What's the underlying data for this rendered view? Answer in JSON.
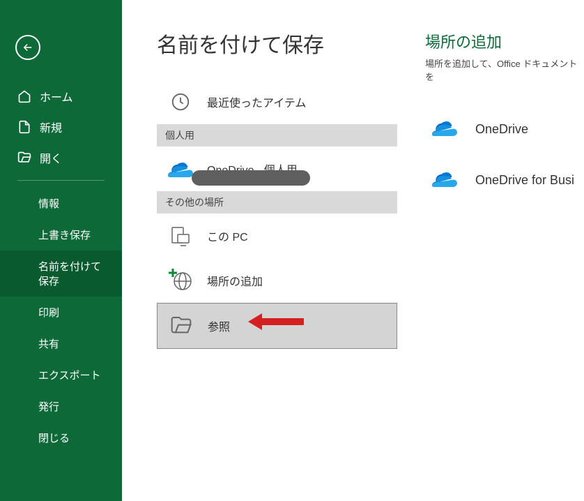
{
  "sidebar": {
    "home": "ホーム",
    "new": "新規",
    "open": "開く",
    "info": "情報",
    "save": "上書き保存",
    "saveas": "名前を付けて保存",
    "print": "印刷",
    "share": "共有",
    "export": "エクスポート",
    "publish": "発行",
    "close": "閉じる"
  },
  "page": {
    "title": "名前を付けて保存"
  },
  "locations": {
    "recent": "最近使ったアイテム",
    "personal_header": "個人用",
    "onedrive_personal": "OneDrive - 個人用",
    "other_header": "その他の場所",
    "this_pc": "この PC",
    "add_location": "場所の追加",
    "browse": "参照"
  },
  "right": {
    "title": "場所の追加",
    "desc": "場所を追加して、Office ドキュメントを",
    "onedrive": "OneDrive",
    "onedrive_business": "OneDrive for Busi"
  }
}
